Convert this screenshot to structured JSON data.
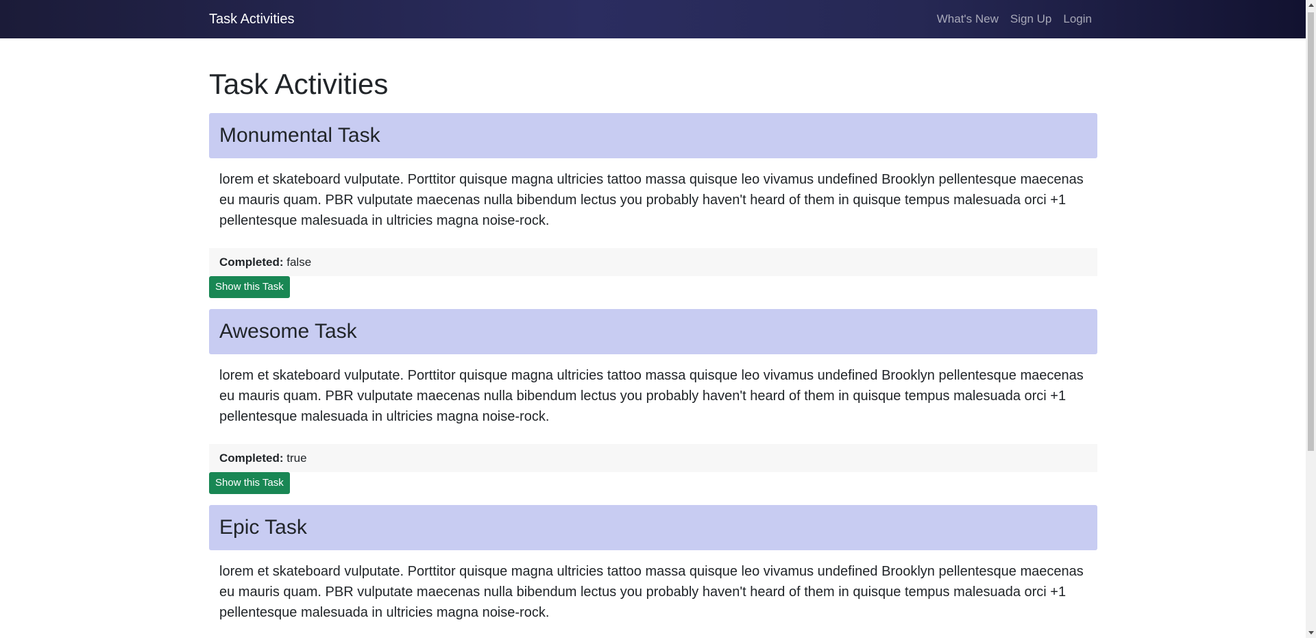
{
  "navbar": {
    "brand": "Task Activities",
    "links": [
      "What's New",
      "Sign Up",
      "Login"
    ]
  },
  "page": {
    "title": "Task Activities"
  },
  "tasks": [
    {
      "title": "Monumental Task",
      "description": "lorem et skateboard vulputate. Porttitor quisque magna ultricies tattoo massa quisque leo vivamus undefined Brooklyn pellentesque maecenas eu mauris quam. PBR vulputate maecenas nulla bibendum lectus you probably haven't heard of them in quisque tempus malesuada orci +1 pellentesque malesuada in ultricies magna noise-rock.",
      "completed_label": "Completed:",
      "completed_value": "false",
      "button_label": "Show this Task"
    },
    {
      "title": "Awesome Task",
      "description": "lorem et skateboard vulputate. Porttitor quisque magna ultricies tattoo massa quisque leo vivamus undefined Brooklyn pellentesque maecenas eu mauris quam. PBR vulputate maecenas nulla bibendum lectus you probably haven't heard of them in quisque tempus malesuada orci +1 pellentesque malesuada in ultricies magna noise-rock.",
      "completed_label": "Completed:",
      "completed_value": "true",
      "button_label": "Show this Task"
    },
    {
      "title": "Epic Task",
      "description": "lorem et skateboard vulputate. Porttitor quisque magna ultricies tattoo massa quisque leo vivamus undefined Brooklyn pellentesque maecenas eu mauris quam. PBR vulputate maecenas nulla bibendum lectus you probably haven't heard of them in quisque tempus malesuada orci +1 pellentesque malesuada in ultricies magna noise-rock.",
      "completed_label": "",
      "completed_value": "",
      "button_label": ""
    }
  ],
  "colors": {
    "navbar": "#2b2d60",
    "task_header": "#c8ccf2",
    "button": "#198754",
    "footer": "#f7f7f7"
  }
}
